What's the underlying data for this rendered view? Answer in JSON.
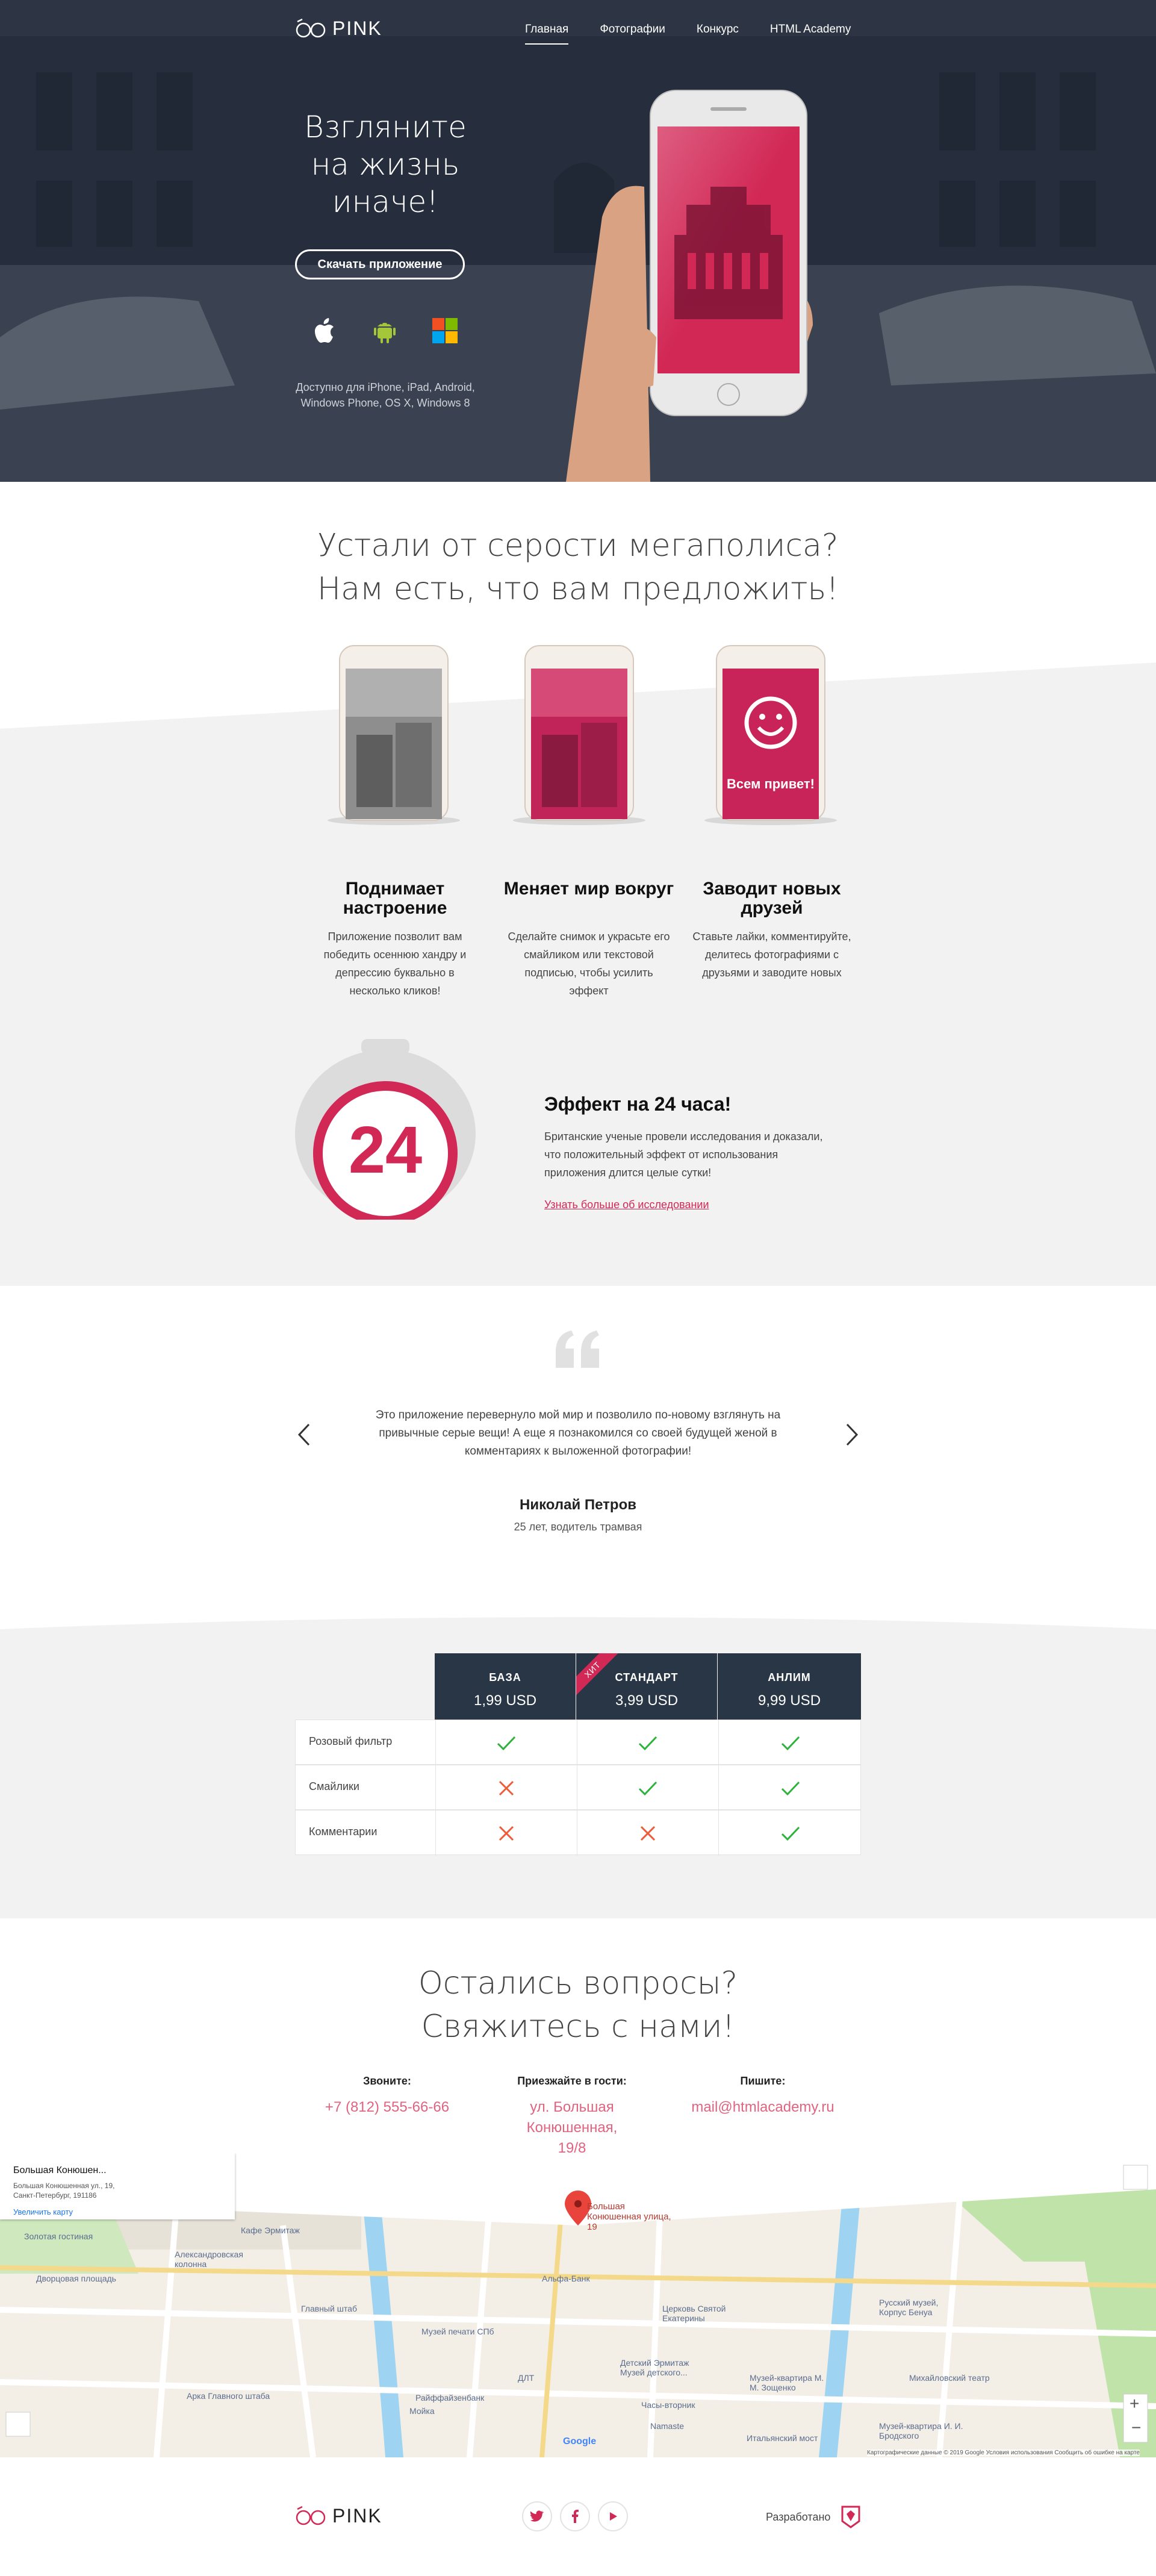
{
  "brand": {
    "logo_text": "PINK",
    "accent": "#d22856",
    "dark": "#283645"
  },
  "nav": {
    "items": [
      "Главная",
      "Фотографии",
      "Конкурс",
      "HTML Academy"
    ],
    "active_index": 0
  },
  "hero": {
    "title": "Взгляните на жизнь иначе!",
    "button": "Скачать приложение",
    "platform_icons": [
      "apple-icon",
      "android-icon",
      "windows-icon"
    ],
    "availability": "Доступно для iPhone, iPad, Android, Windows Phone, OS X, Windows 8"
  },
  "features": {
    "title_line1": "Устали от серости мегаполиса?",
    "title_line2": "Нам есть, что вам предложить!",
    "items": [
      {
        "title": "Поднимает настроение",
        "text": "Приложение позволит вам победить осеннюю хандру и депрессию буквально в несколько кликов!"
      },
      {
        "title": "Меняет мир вокруг",
        "text": "Сделайте снимок и украсьте его смайликом или текстовой подписью, чтобы усилить эффект"
      },
      {
        "title": "Заводит новых друзей",
        "text": "Ставьте лайки, комментируйте, делитесь фотографиями с друзьями и заводите новых"
      }
    ],
    "phone_caption": "Всем привет!",
    "effect": {
      "timer": "24",
      "title": "Эффект на 24 часа!",
      "text": "Британские ученые провели исследования и доказали, что положительный эффект от использования приложения длится целые сутки!",
      "link": "Узнать больше об исследовании"
    }
  },
  "review": {
    "text": "Это приложение перевернуло мой мир и позволило по-новому взглянуть на привычные серые вещи! А еще я познакомился со своей будущей женой в комментариях к выложенной фотографии!",
    "author": "Николай Петров",
    "role": "25 лет, водитель трамвая"
  },
  "prices": {
    "plans": [
      {
        "name": "БАЗА",
        "price": "1,99 USD"
      },
      {
        "name": "СТАНДАРТ",
        "price": "3,99 USD",
        "badge": "ХИТ"
      },
      {
        "name": "АНЛИМ",
        "price": "9,99 USD"
      }
    ],
    "rows": [
      {
        "label": "Розовый фильтр",
        "values": [
          true,
          true,
          true
        ]
      },
      {
        "label": "Смайлики",
        "values": [
          false,
          true,
          true
        ]
      },
      {
        "label": "Комментарии",
        "values": [
          false,
          false,
          true
        ]
      }
    ]
  },
  "contacts": {
    "title_line1": "Остались вопросы?",
    "title_line2": "Свяжитесь с нами!",
    "phone_label": "Звоните:",
    "phone": "+7 (812) 555-66-66",
    "address_label": "Приезжайте в гости:",
    "address": "ул. Большая Конюшенная, 19/8",
    "mail_label": "Пишите:",
    "mail": "mail@htmlacademy.ru"
  },
  "map": {
    "card_title": "Большая Конюшен...",
    "card_address": "Большая Конюшенная ул., 19, Санкт-Петербург, 191186",
    "card_link": "Увеличить карту",
    "marker_label": "Большая Конюшенная улица, 19",
    "labels": [
      "Золотая гостиная",
      "Дворцовая площадь",
      "Александровская колонна",
      "Кафе Эрмитаж",
      "Главный штаб",
      "Музей печати СПб",
      "Арка Главного штаба",
      "Райффайзенбанк",
      "Альфа-Банк",
      "Церковь Святой Екатерины",
      "Детский Эрмитаж Музей детского...",
      "Музей-квартира М. М. Зощенко",
      "Русский музей, Корпус Бенуа",
      "Михайловский театр",
      "Часы-вторник",
      "Итальянский мост",
      "Музей-квартира И. И. Бродского",
      "Namaste",
      "ДЛТ",
      "Мойка"
    ],
    "google": "Google",
    "attribution": "Картографические данные © 2019 Google   Условия использования   Сообщить об ошибке на карте"
  },
  "footer": {
    "logo_text": "PINK",
    "social": [
      "twitter-icon",
      "facebook-icon",
      "youtube-icon"
    ],
    "dev_label": "Разработано"
  }
}
